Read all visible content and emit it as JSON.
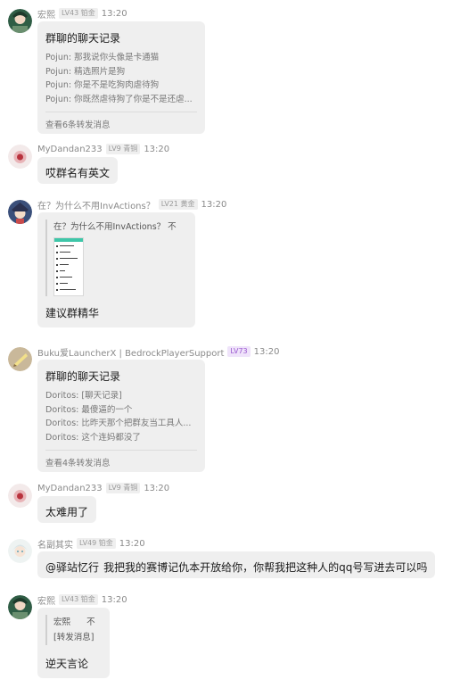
{
  "messages": [
    {
      "sender": "宏熙",
      "badge": "LV43 铂金",
      "time": "13:20",
      "forward": {
        "title": "群聊的聊天记录",
        "lines": [
          "Pojun: 那我说你头像是卡通猫",
          "Pojun: 精选照片是狗",
          "Pojun: 你是不是吃狗肉虐待狗",
          "Pojun: 你既然虐待狗了你是不是还虐..."
        ],
        "more": "查看6条转发消息"
      }
    },
    {
      "sender": "MyDandan233",
      "badge": "LV9 青铜",
      "time": "13:20",
      "text": "哎群名有英文"
    },
    {
      "sender": "在？为什么不用InvActions？",
      "badge": "LV21 黄金",
      "time": "13:20",
      "quote_title": "在？为什么不用InvActions？  不",
      "text": "建议群精华"
    },
    {
      "sender": "Buku爱LauncherX | BedrockPlayerSupport",
      "badge": "LV73",
      "time": "13:20",
      "forward": {
        "title": "群聊的聊天记录",
        "lines": [
          "Doritos: [聊天记录]",
          "Doritos: 最傻逼的一个",
          "Doritos: 比昨天那个把群友当工具人...",
          "Doritos: 这个连妈都没了"
        ],
        "more": "查看4条转发消息"
      }
    },
    {
      "sender": "MyDandan233",
      "badge": "LV9 青铜",
      "time": "13:20",
      "text": "太难用了"
    },
    {
      "sender": "名副其实",
      "badge": "LV49 铂金",
      "time": "13:20",
      "mention": "@驿站忆行",
      "text": "我把我的赛博记仇本开放给你，你帮我把这种人的qq号写进去可以吗"
    },
    {
      "sender": "宏熙",
      "badge": "LV43 铂金",
      "time": "13:20",
      "quote_lines": [
        "宏熙      不",
        "[转发消息]"
      ],
      "text": "逆天言论"
    }
  ],
  "colors": {
    "bubble": "#efefef",
    "meta_text": "#8a8a8a",
    "mention": "#b17fe0",
    "badge_purple": "#9b59d0"
  },
  "icons": {
    "avatars": [
      "avatar-green-anime",
      "avatar-red-flower",
      "avatar-anime-girl-hat",
      "avatar-paper-note",
      "avatar-red-flower",
      "avatar-white-hair-anime",
      "avatar-green-anime"
    ]
  }
}
